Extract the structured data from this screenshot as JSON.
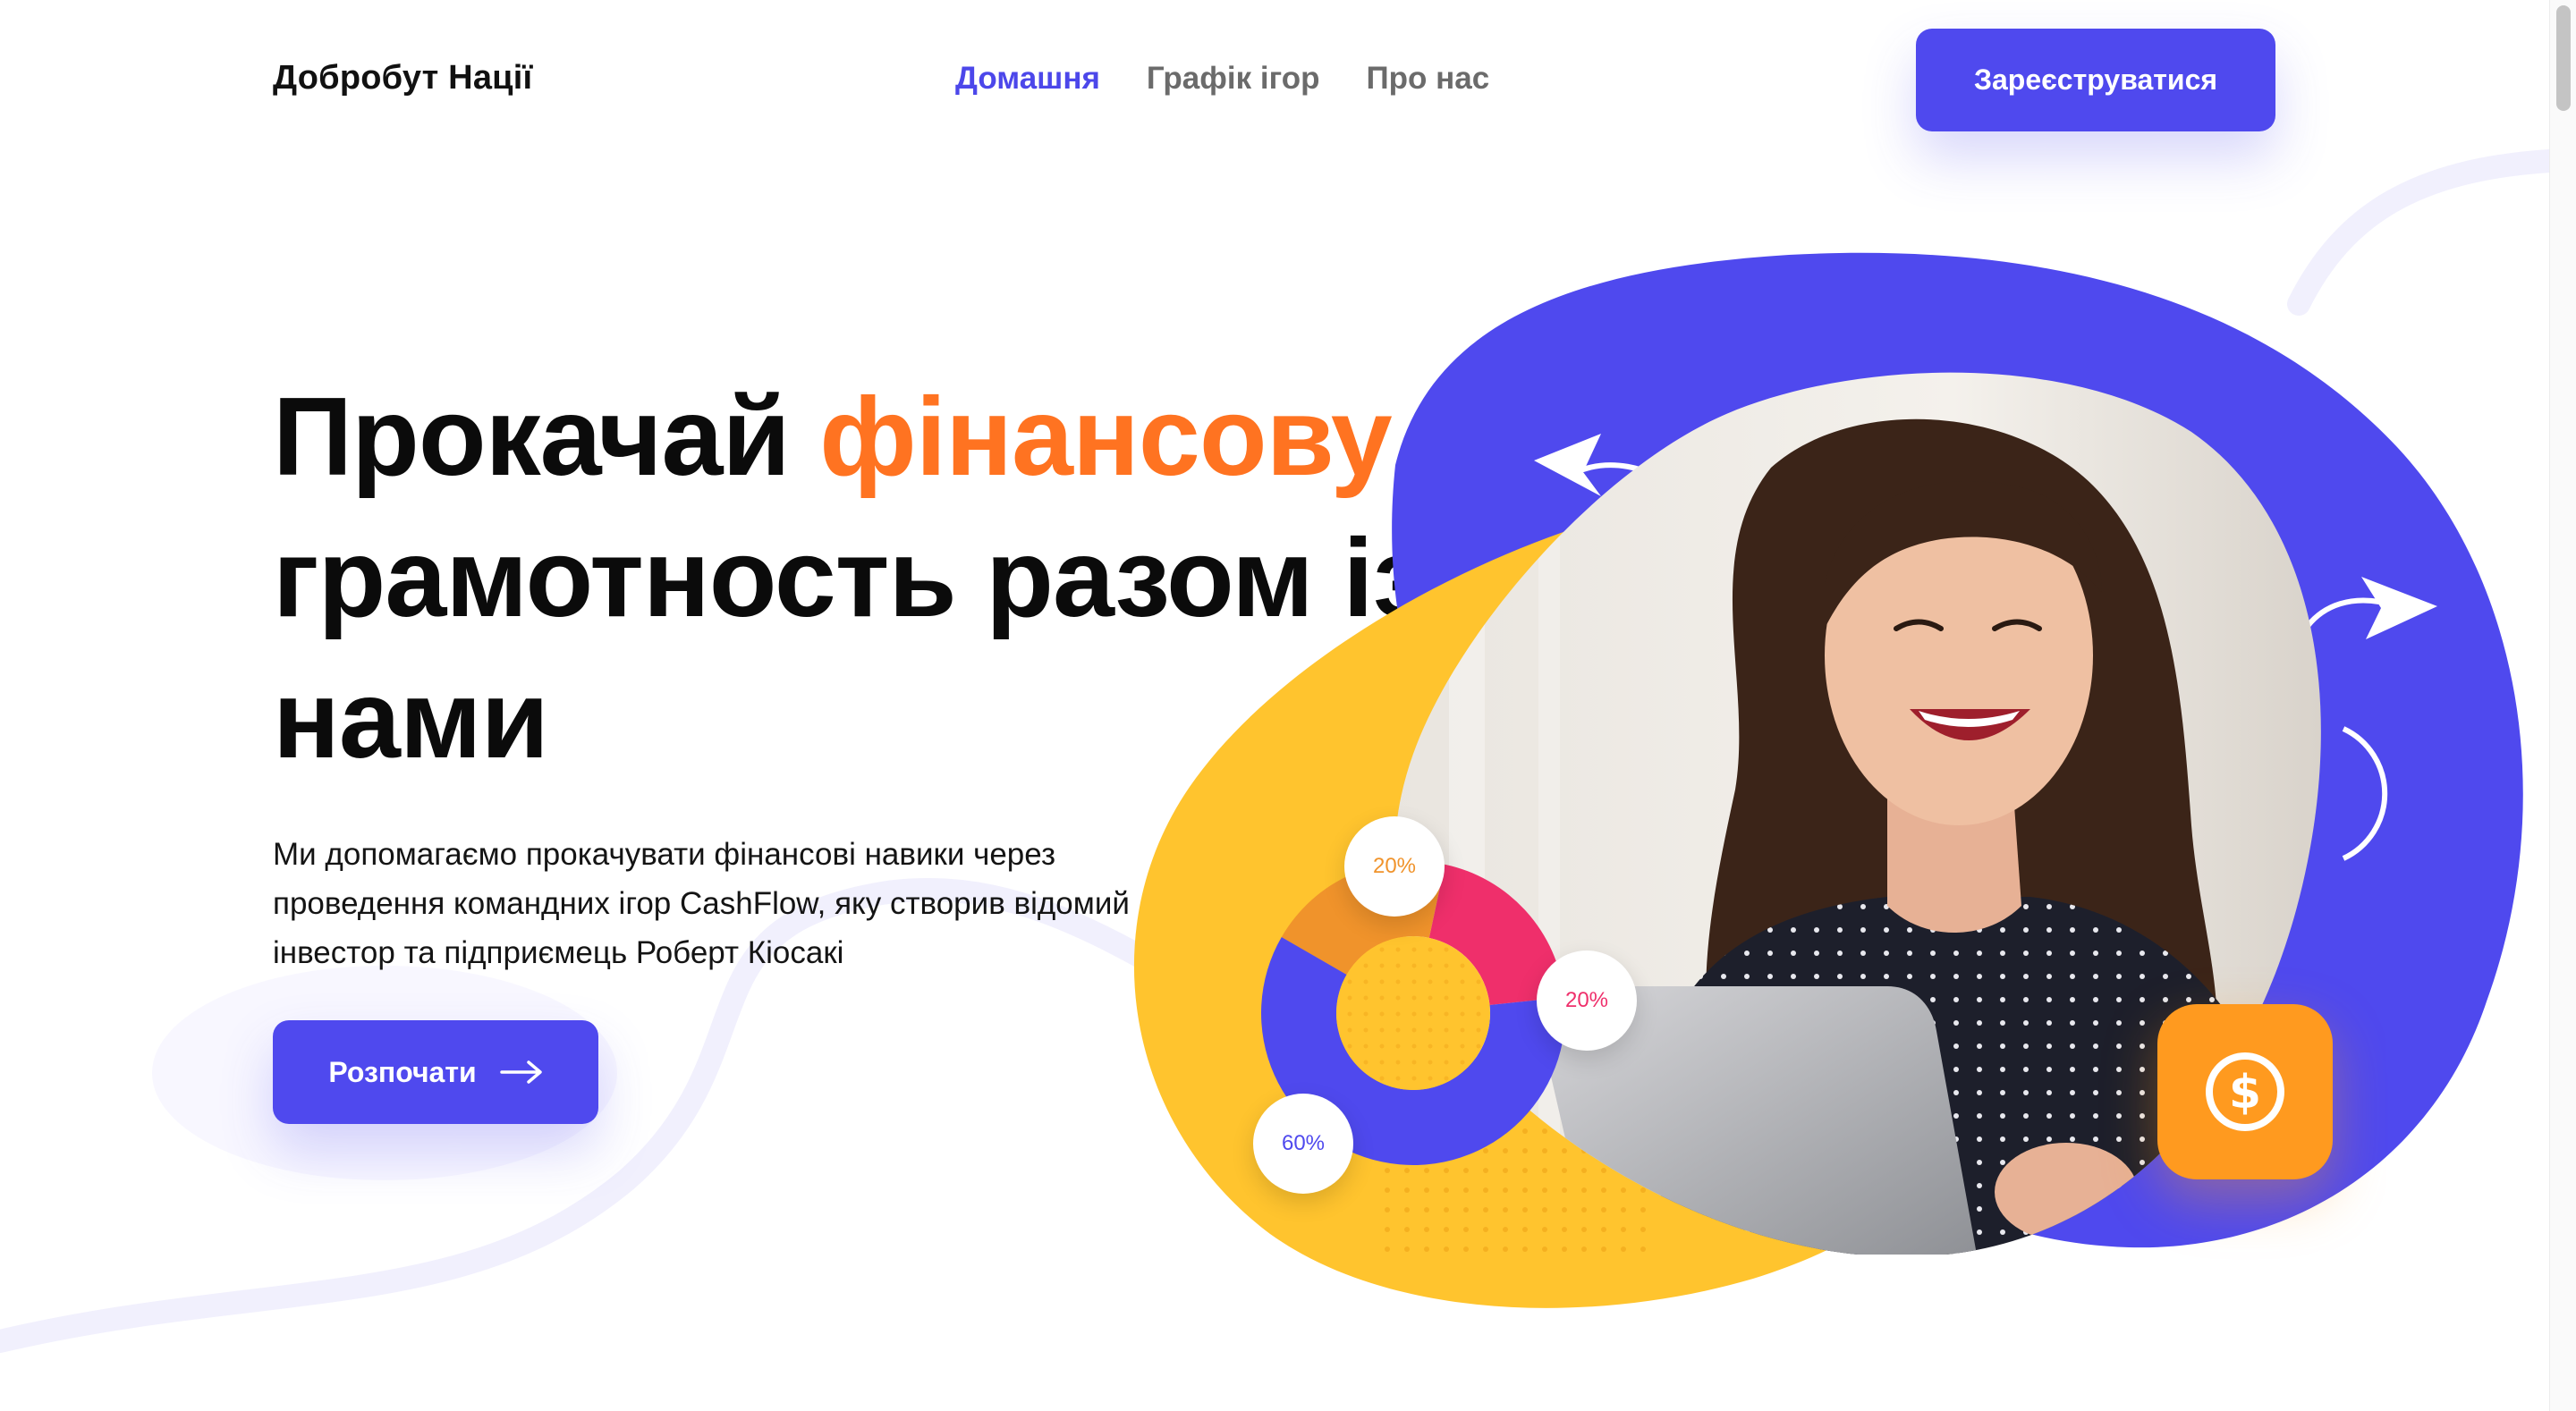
{
  "header": {
    "logo": "Добробут Нації",
    "nav": [
      {
        "label": "Домашня",
        "active": true
      },
      {
        "label": "Графік ігор",
        "active": false
      },
      {
        "label": "Про нас",
        "active": false
      }
    ],
    "register_label": "Зареєструватися"
  },
  "hero": {
    "title_part1": "Прокачай ",
    "title_accent": "фінансову",
    "title_part2": "грамотность разом із",
    "title_part3": "нами",
    "description": "Ми допомагаємо прокачувати фінансові навики через проведення командних ігор CashFlow, яку створив відомий інвестор та підприємець Роберт Кіосакі",
    "start_label": "Розпочати"
  },
  "illustration": {
    "donut": [
      {
        "label": "20%",
        "value": 20,
        "color": "#f0932b"
      },
      {
        "label": "20%",
        "value": 20,
        "color": "#ef2f6b"
      },
      {
        "label": "60%",
        "value": 60,
        "color": "#4f49ee"
      }
    ],
    "coin_icon": "dollar-coin-icon",
    "arrow_icons": [
      "curved-arrow-left-icon",
      "curved-arrow-right-icon"
    ]
  },
  "colors": {
    "primary": "#4f49ee",
    "accent_orange": "#ff7321",
    "yellow_blob": "#ffc42e",
    "blue_blob": "#4f49ee",
    "coin_orange": "#ff9a1f"
  }
}
